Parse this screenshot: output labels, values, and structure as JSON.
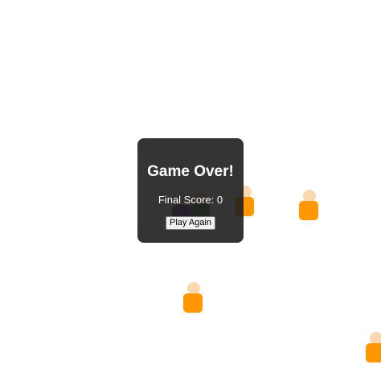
{
  "game": {
    "state": "game-over",
    "colors": {
      "background": "#ffffff",
      "panel": "#1e1e1e",
      "sprite_body": "#ff9800",
      "sprite_head": "#fbd8b0",
      "sprite_purple": "#7b1fa2",
      "sprite_green": "#2e7d32"
    }
  },
  "overlay": {
    "title": "Game Over!",
    "score_text": "Final Score: 0",
    "play_again_label": "Play Again"
  }
}
